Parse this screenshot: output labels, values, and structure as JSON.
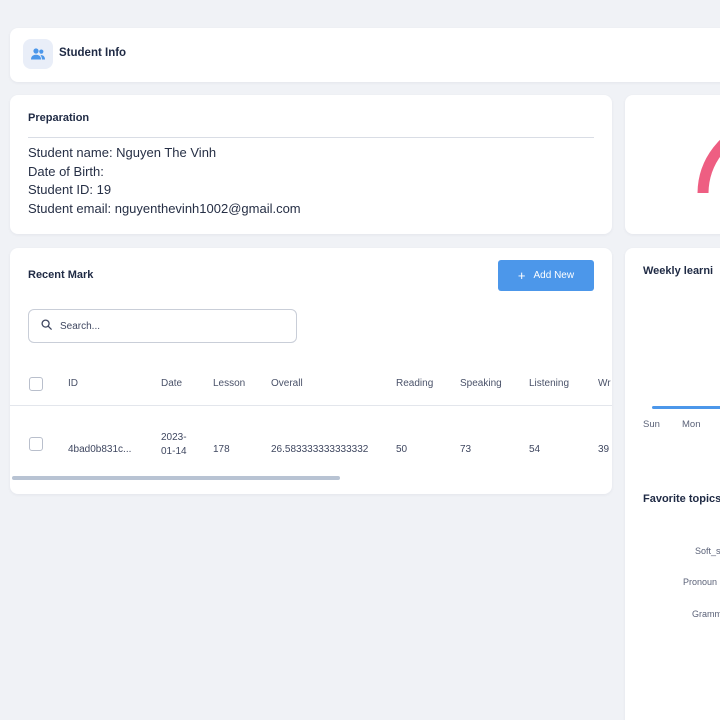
{
  "header": {
    "title": "Student Info",
    "icon": "users-icon"
  },
  "preparation": {
    "title": "Preparation",
    "lines": [
      "Student name: Nguyen The Vinh",
      "Date of Birth:",
      "Student ID: 19",
      "Student email: nguyenthevinh1002@gmail.com"
    ]
  },
  "recent_mark": {
    "title": "Recent Mark",
    "add_button_label": "Add New",
    "search_placeholder": "Search...",
    "columns": [
      "ID",
      "Date",
      "Lesson",
      "Overall",
      "Reading",
      "Speaking",
      "Listening",
      "Wr"
    ],
    "rows": [
      {
        "id": "4bad0b831c...",
        "date_line1": "2023-",
        "date_line2": "01-14",
        "lesson": "178",
        "overall": "26.583333333333332",
        "reading": "50",
        "speaking": "73",
        "listening": "54",
        "writing": "39"
      }
    ]
  },
  "weekly": {
    "title": "Weekly learni",
    "days": [
      "Sun",
      "Mon"
    ]
  },
  "favorite_topics": {
    "title": "Favorite topics",
    "topics": [
      "Soft_s",
      "Pronoun",
      "Gramm"
    ]
  },
  "colors": {
    "accent": "#4c97ea",
    "gauge": "#ee5e82",
    "background": "#f0f2f6"
  }
}
